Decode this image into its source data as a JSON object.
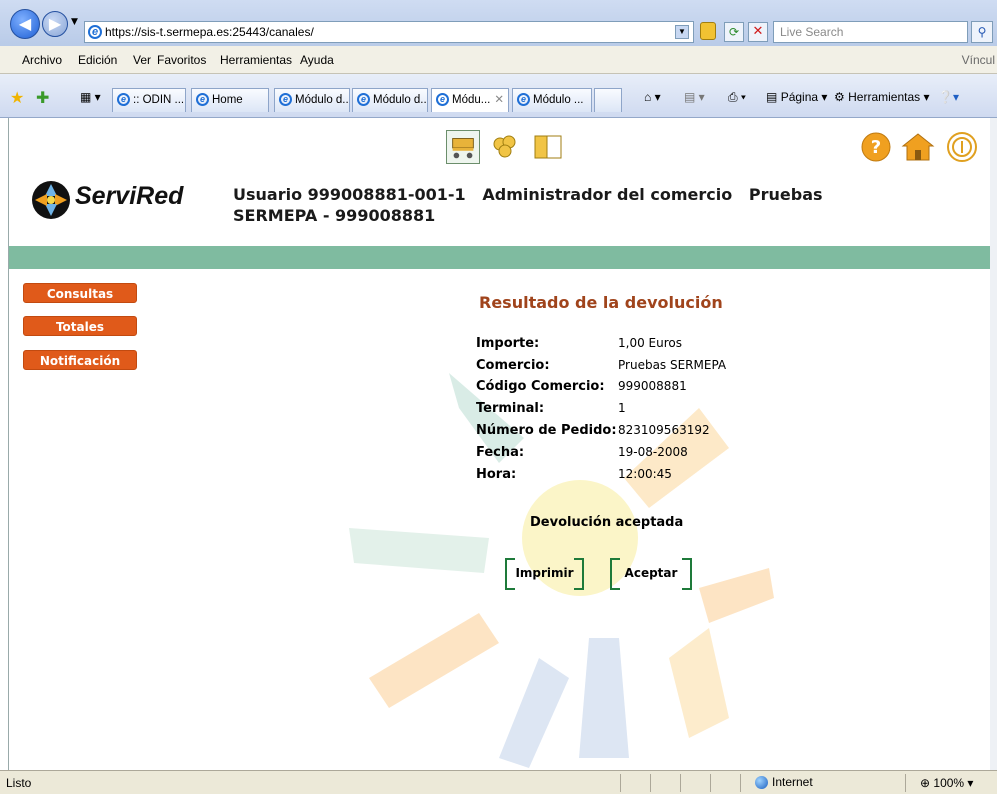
{
  "browser": {
    "url": "https://sis-t.sermepa.es:25443/canales/",
    "search_placeholder": "Live Search",
    "menu": [
      "Archivo",
      "Edición",
      "Ver",
      "Favoritos",
      "Herramientas",
      "Ayuda"
    ],
    "menu_right": "Víncul",
    "tabs": [
      {
        "label": ":: ODIN ...",
        "active": false
      },
      {
        "label": "Home",
        "active": false
      },
      {
        "label": "Módulo d...",
        "active": false
      },
      {
        "label": "Módulo d...",
        "active": false
      },
      {
        "label": "Módu...",
        "active": true
      },
      {
        "label": "Módulo ...",
        "active": false
      }
    ],
    "toolbar": {
      "page_label": "Página",
      "tools_label": "Herramientas"
    },
    "status": {
      "text": "Listo",
      "zone": "Internet",
      "zoom": "100%"
    }
  },
  "header": {
    "logo_text": "ServiRed",
    "user_line1": "Usuario 999008881-001-1   Administrador del comercio   Pruebas",
    "user_line2": "SERMEPA - 999008881",
    "top_icons": [
      "cart-icon",
      "users-icon",
      "book-icon"
    ],
    "right_icons": [
      "help-icon",
      "home-icon",
      "info-icon"
    ]
  },
  "sidebar": {
    "items": [
      {
        "label": "Consultas"
      },
      {
        "label": "Totales"
      },
      {
        "label": "Notificación"
      }
    ]
  },
  "result": {
    "title": "Resultado de la devolución",
    "fields": [
      {
        "label": "Importe:",
        "value": "1,00 Euros"
      },
      {
        "label": "Comercio:",
        "value": "Pruebas SERMEPA"
      },
      {
        "label": "Código Comercio:",
        "value": "999008881"
      },
      {
        "label": "Terminal:",
        "value": "1"
      },
      {
        "label": "Número de Pedido:",
        "value": "823109563192"
      },
      {
        "label": "Fecha:",
        "value": "19-08-2008"
      },
      {
        "label": "Hora:",
        "value": "12:00:45"
      }
    ],
    "status": "Devolución aceptada",
    "print_label": "Imprimir",
    "accept_label": "Aceptar"
  },
  "colors": {
    "accent_green": "#7fbba0",
    "button_orange": "#e05a1a",
    "title_brown": "#a0441c",
    "bracket_green": "#1e7a3a"
  }
}
